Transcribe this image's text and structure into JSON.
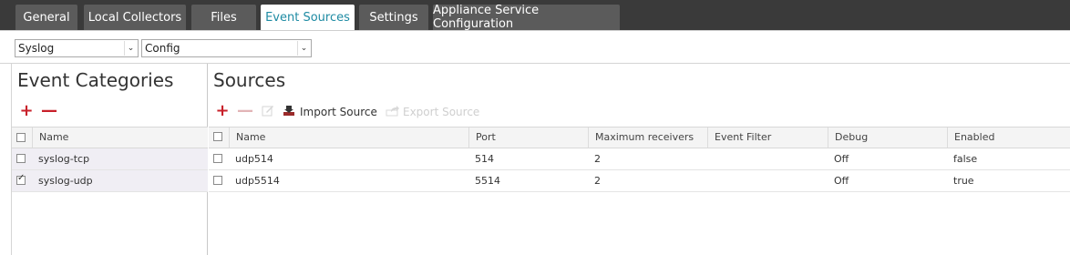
{
  "tabs": [
    {
      "label": "General"
    },
    {
      "label": "Local Collectors"
    },
    {
      "label": "Files"
    },
    {
      "label": "Event Sources"
    },
    {
      "label": "Settings"
    },
    {
      "label": "Appliance Service Configuration"
    }
  ],
  "filters": {
    "type_value": "Syslog",
    "mode_value": "Config"
  },
  "left_panel": {
    "title": "Event Categories",
    "column_name": "Name",
    "rows": [
      {
        "name": "syslog-tcp",
        "checked": false
      },
      {
        "name": "syslog-udp",
        "checked": true
      }
    ]
  },
  "right_panel": {
    "title": "Sources",
    "import_label": "Import Source",
    "export_label": "Export Source",
    "columns": [
      "Name",
      "Port",
      "Maximum receivers",
      "Event Filter",
      "Debug",
      "Enabled"
    ],
    "rows": [
      {
        "name": "udp514",
        "port": "514",
        "max": "2",
        "filter": "",
        "debug": "Off",
        "enabled": "false"
      },
      {
        "name": "udp5514",
        "port": "5514",
        "max": "2",
        "filter": "",
        "debug": "Off",
        "enabled": "true"
      }
    ]
  },
  "colors": {
    "accent": "#1e8ba3",
    "add": "#c8202a"
  }
}
